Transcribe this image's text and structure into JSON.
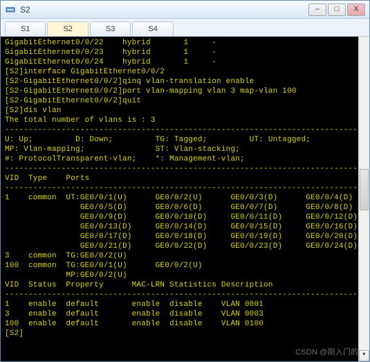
{
  "window": {
    "title": "S2",
    "icon": "network-device-icon",
    "buttons": {
      "min": "–",
      "max": "□",
      "close": "X"
    }
  },
  "tabs": [
    "S1",
    "S2",
    "S3",
    "S4"
  ],
  "active_tab": 1,
  "terminal_lines": [
    "GigabitEthernet0/0/22    hybrid       1     -",
    "GigabitEthernet0/0/23    hybrid       1     -",
    "GigabitEthernet0/0/24    hybrid       1     -",
    "[S2]interface GigabitEthernet0/0/2",
    "[S2-GigabitEthernet0/0/2]qinq vlan-translation enable",
    "[S2-GigabitEthernet0/0/2]port vlan-mapping vlan 3 map-vlan 100",
    "[S2-GigabitEthernet0/0/2]quit",
    "[S2]dis vlan",
    "The total number of vlans is : 3",
    "--------------------------------------------------------------------------------",
    "U: Up;         D: Down;         TG: Tagged;         UT: Untagged;",
    "MP: Vlan-mapping;               ST: Vlan-stacking;",
    "#: ProtocolTransparent-vlan;    *: Management-vlan;",
    "--------------------------------------------------------------------------------",
    "",
    "VID  Type    Ports",
    "--------------------------------------------------------------------------------",
    "1    common  UT:GE0/0/1(U)      GE0/0/2(U)      GE0/0/3(D)      GE0/0/4(D)",
    "                GE0/0/5(D)      GE0/0/6(D)      GE0/0/7(D)      GE0/0/8(D)",
    "                GE0/0/9(D)      GE0/0/10(D)     GE0/0/11(D)     GE0/0/12(D)",
    "                GE0/0/13(D)     GE0/0/14(D)     GE0/0/15(D)     GE0/0/16(D)",
    "                GE0/0/17(D)     GE0/0/18(D)     GE0/0/19(D)     GE0/0/20(D)",
    "                GE0/0/21(D)     GE0/0/22(D)     GE0/0/23(D)     GE0/0/24(D)",
    "",
    "3    common  TG:GE0/0/2(U)",
    "",
    "100  common  TG:GE0/0/1(U)      GE0/0/2(U)",
    "             MP:GE0/0/2(U)",
    "",
    "",
    "VID  Status  Property      MAC-LRN Statistics Description",
    "--------------------------------------------------------------------------------",
    "",
    "1    enable  default       enable  disable    VLAN 0001",
    "3    enable  default       enable  disable    VLAN 0003",
    "100  enable  default       enable  disable    VLAN 0100",
    "[S2]"
  ],
  "watermark": "CSDN @刚入门的K"
}
